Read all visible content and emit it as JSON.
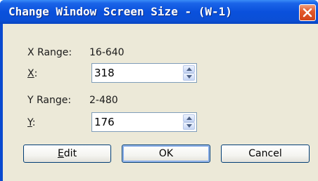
{
  "window": {
    "title": "Change Window Screen Size - (W-1)"
  },
  "x_range": {
    "label": "X Range:",
    "value": "16-640"
  },
  "x_field": {
    "mnemonic": "X",
    "suffix": ":",
    "value": "318"
  },
  "y_range": {
    "label": "Y Range:",
    "value": "2-480"
  },
  "y_field": {
    "mnemonic": "Y",
    "suffix": ":",
    "value": "176"
  },
  "buttons": {
    "edit_mnemonic": "E",
    "edit_rest": "dit",
    "ok_label": "OK",
    "cancel_label": "Cancel"
  },
  "icons": {
    "close": "close-icon",
    "spin_up": "arrow-up-icon",
    "spin_down": "arrow-down-icon"
  },
  "colors": {
    "titlebar": "#0a50dc",
    "client": "#ece9d8",
    "close_button": "#e3592c"
  }
}
